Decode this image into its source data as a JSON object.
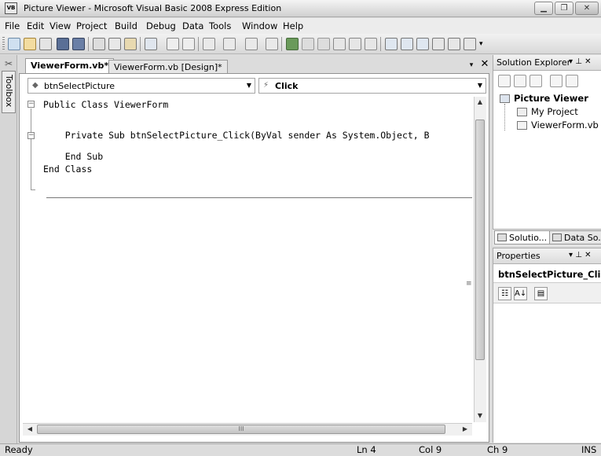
{
  "window": {
    "title": "Picture Viewer - Microsoft Visual Basic 2008 Express Edition",
    "app_icon": "VB"
  },
  "window_controls": {
    "minimize": "▁",
    "maximize": "❐",
    "close": "✕"
  },
  "menu": [
    "File",
    "Edit",
    "View",
    "Project",
    "Build",
    "Debug",
    "Data",
    "Tools",
    "Window",
    "Help"
  ],
  "toolbox": {
    "label": "Toolbox"
  },
  "tabs": [
    {
      "label": "ViewerForm.vb*",
      "active": true
    },
    {
      "label": "ViewerForm.vb [Design]*",
      "active": false
    }
  ],
  "tab_controls": {
    "dropdown": "▾",
    "close": "✕"
  },
  "editor": {
    "object_combo": "btnSelectPicture",
    "event_combo": "Click",
    "code_lines": [
      "Public Class ViewerForm",
      "",
      "    Private Sub btnSelectPicture_Click(ByVal sender As System.Object, B",
      "",
      "    End Sub",
      "End Class"
    ],
    "hscroll_grip": "III"
  },
  "solution_explorer": {
    "title": "Solution Explorer",
    "pin": "▾ ⊥ ✕",
    "project": "Picture Viewer",
    "items": [
      "My Project",
      "ViewerForm.vb"
    ],
    "tabs": [
      "Solutio...",
      "Data So..."
    ]
  },
  "properties": {
    "title": "Properties",
    "pin": "▾ ⊥ ✕",
    "selected_object": "btnSelectPicture_Click"
  },
  "status": {
    "message": "Ready",
    "line": "Ln 4",
    "col": "Col 9",
    "ch": "Ch 9",
    "mode": "INS"
  }
}
